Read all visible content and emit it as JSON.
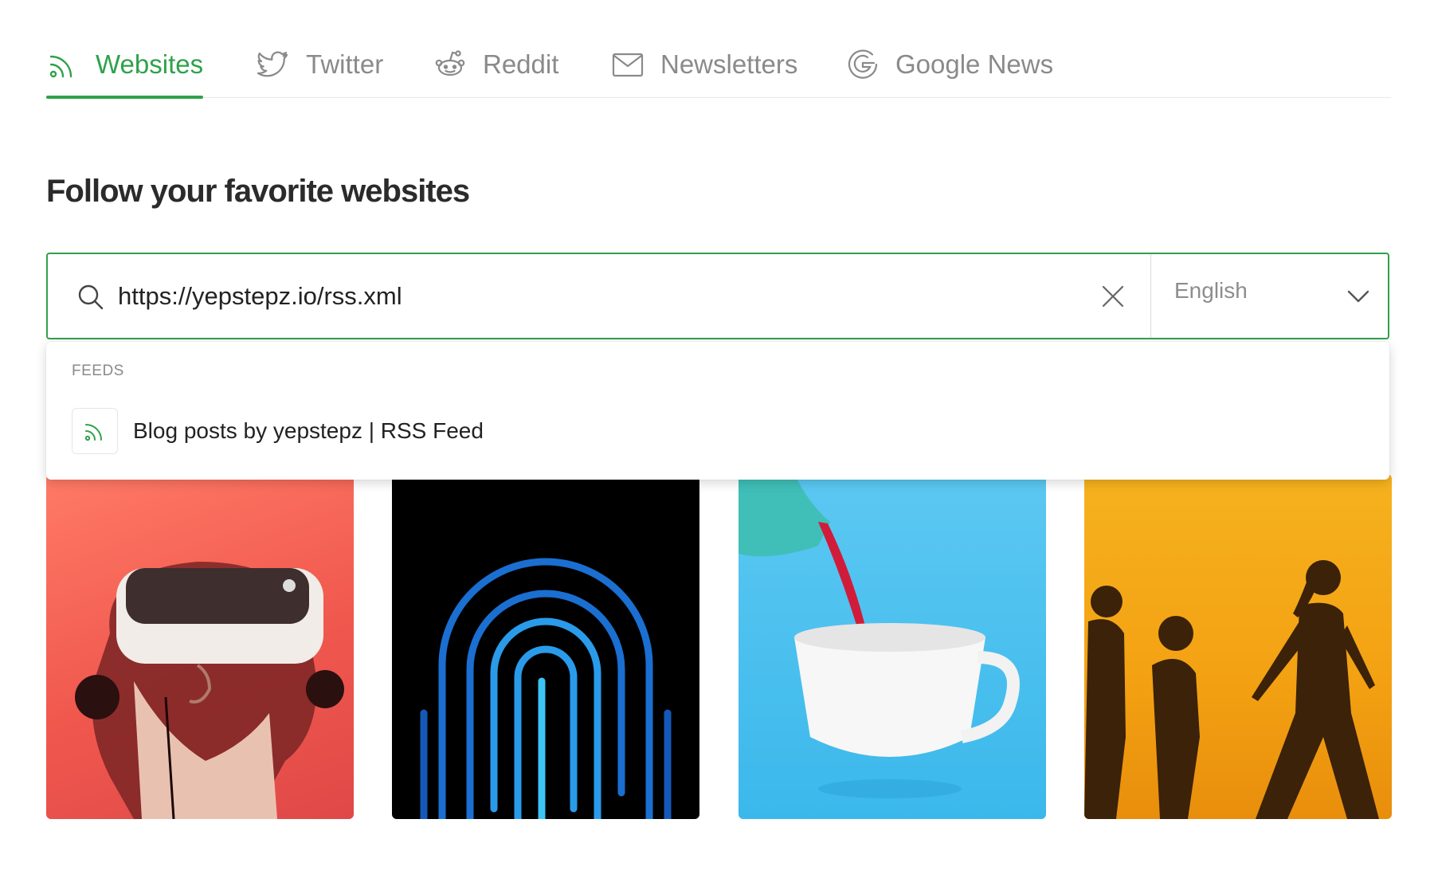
{
  "tabs": [
    {
      "label": "Websites",
      "icon": "rss-icon",
      "active": true
    },
    {
      "label": "Twitter",
      "icon": "twitter-icon",
      "active": false
    },
    {
      "label": "Reddit",
      "icon": "reddit-icon",
      "active": false
    },
    {
      "label": "Newsletters",
      "icon": "mail-icon",
      "active": false
    },
    {
      "label": "Google News",
      "icon": "google-icon",
      "active": false
    }
  ],
  "page": {
    "heading": "Follow your favorite websites"
  },
  "search": {
    "value": "https://yepstepz.io/rss.xml",
    "language": "English"
  },
  "dropdown": {
    "section_label": "FEEDS",
    "items": [
      {
        "label": "Blog posts by yepstepz | RSS Feed",
        "icon": "rss-icon"
      }
    ]
  },
  "cards": [
    {
      "image": "vr-headset-person",
      "bg": "#f0584e"
    },
    {
      "image": "fingerprint",
      "bg": "#000000"
    },
    {
      "image": "teapot-pouring-cup",
      "bg": "#3bb8eb"
    },
    {
      "image": "people-silhouettes-walking",
      "bg": "#f3a112"
    }
  ],
  "colors": {
    "accent": "#2ea24a",
    "muted": "#8a8a8a"
  }
}
